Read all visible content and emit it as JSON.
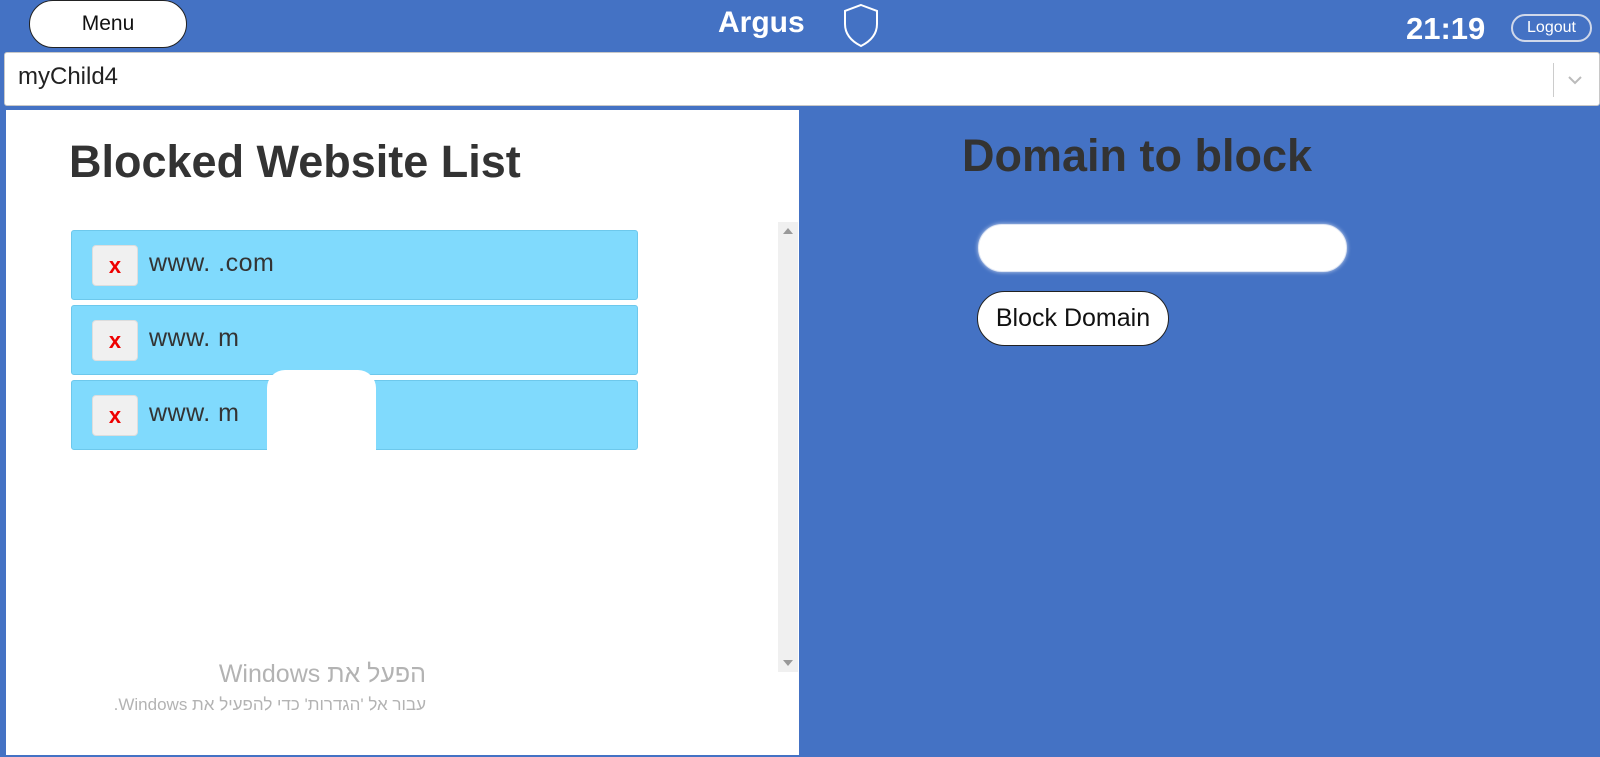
{
  "header": {
    "menu_label": "Menu",
    "brand": "Argus",
    "time": "21:19",
    "logout_label": "Logout",
    "brand_icon": "shield-icon"
  },
  "child_select": {
    "selected": "myChild4",
    "icon": "chevron-down-icon"
  },
  "blocked_list": {
    "title": "Blocked Website List",
    "remove_label": "x",
    "items": [
      {
        "domain": "www.          .com"
      },
      {
        "domain": "www.          m"
      },
      {
        "domain": "www.          m"
      }
    ]
  },
  "block_form": {
    "title": "Domain to block",
    "input_value": "",
    "button_label": "Block Domain"
  },
  "watermark": {
    "line1": "הפעל את Windows",
    "line2": "עבור אל 'הגדרות' כדי להפעיל את Windows."
  },
  "colors": {
    "background": "#4472C4",
    "list_item": "#80DAFD",
    "remove_x": "#EE0000"
  }
}
